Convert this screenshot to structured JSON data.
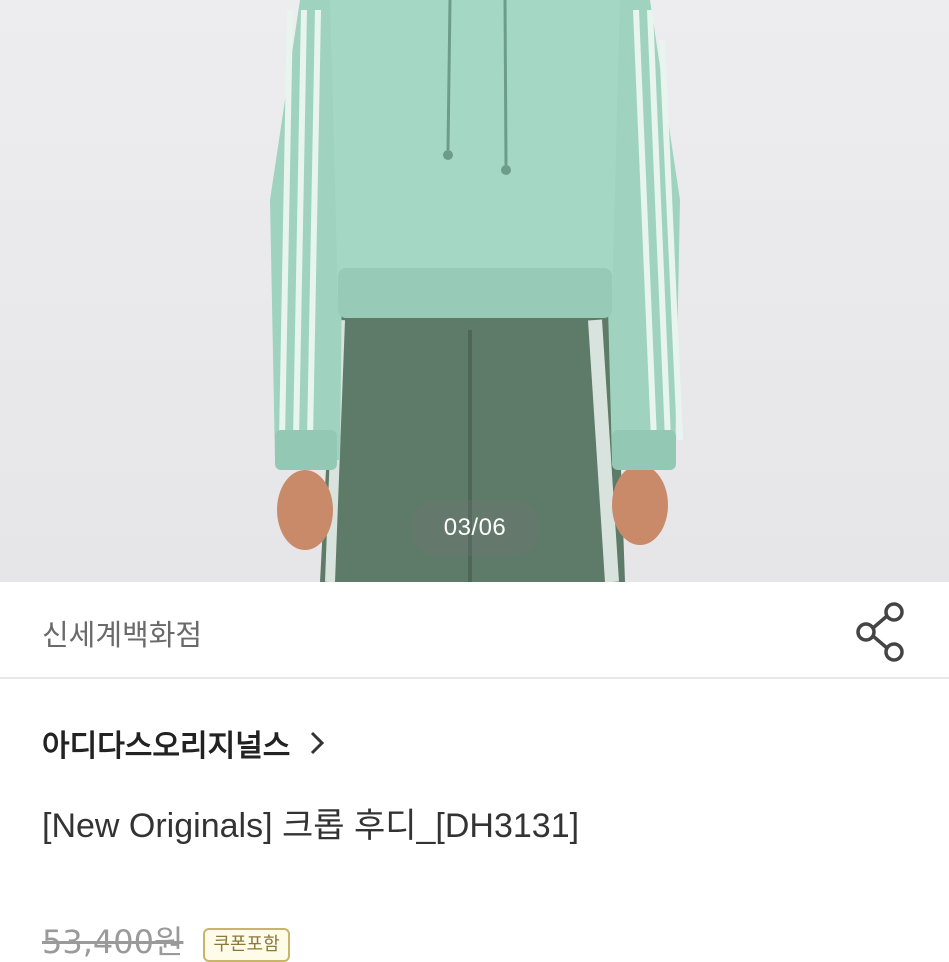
{
  "gallery": {
    "counter": "03/06"
  },
  "store": {
    "name": "신세계백화점",
    "share_icon": "share-icon"
  },
  "brand": {
    "name": "아디다스오리지널스",
    "chevron_icon": "chevron-right-icon"
  },
  "product": {
    "title": "[New Originals] 크롭 후디_[DH3131]"
  },
  "pricing": {
    "original_price": "53,400원",
    "coupon_badge": "쿠폰포함"
  },
  "colors": {
    "hoodie": "#9fd3bf",
    "pants": "#5e7a68",
    "stripe": "#e8f5ef",
    "background": "#ececee"
  }
}
